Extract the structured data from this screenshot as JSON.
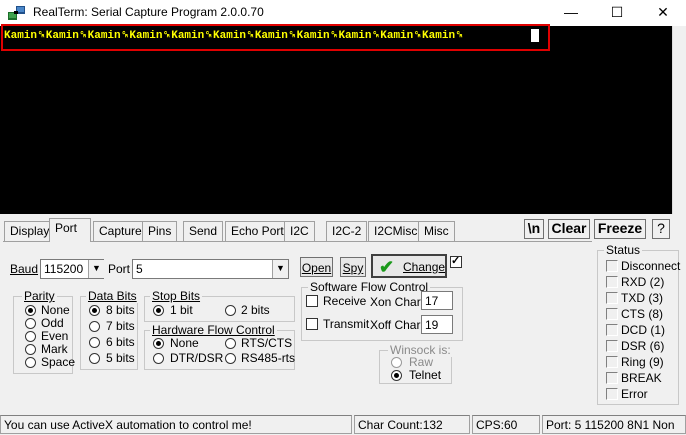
{
  "window": {
    "title": "RealTerm: Serial Capture Program 2.0.0.70",
    "min_icon": "minimize-icon",
    "max_icon": "maximize-icon",
    "close_icon": "close-icon"
  },
  "terminal": {
    "text": "Kamin␍Kamin␍Kamin␍Kamin␍Kamin␍Kamin␍Kamin␍Kamin␍Kamin␍Kamin␍Kamin␍",
    "text_color": "#ffff00",
    "background": "#000000",
    "highlight_color": "#e00000"
  },
  "tabs": [
    "Display",
    "Port",
    "Capture",
    "Pins",
    "Send",
    "Echo Port",
    "I2C",
    "I2C-2",
    "I2CMisc",
    "Misc"
  ],
  "active_tab": "Port",
  "top_buttons": {
    "newline": "\\n",
    "clear": "Clear",
    "freeze": "Freeze",
    "help": "?"
  },
  "port": {
    "baud_label": "Baud",
    "baud_value": "115200",
    "port_label": "Port",
    "port_value": "5",
    "open_label": "Open",
    "spy_label": "Spy",
    "change_label": "Change",
    "change_checked": true
  },
  "parity": {
    "title": "Parity",
    "options": [
      "None",
      "Odd",
      "Even",
      "Mark",
      "Space"
    ],
    "selected": "None"
  },
  "data_bits": {
    "title": "Data Bits",
    "options": [
      "8 bits",
      "7 bits",
      "6 bits",
      "5 bits"
    ],
    "selected": "8 bits"
  },
  "stop_bits": {
    "title": "Stop Bits",
    "options": [
      "1 bit",
      "2 bits"
    ],
    "selected": "1 bit"
  },
  "hw_flow": {
    "title": "Hardware Flow Control",
    "options": [
      "None",
      "RTS/CTS",
      "DTR/DSR",
      "RS485-rts"
    ],
    "selected": "None"
  },
  "sw_flow": {
    "title": "Software Flow Control",
    "receive_label": "Receive",
    "transmit_label": "Transmit",
    "xon_label": "Xon Char:",
    "xon_value": "17",
    "xoff_label": "Xoff Char:",
    "xoff_value": "19"
  },
  "winsock": {
    "title": "Winsock is:",
    "options": [
      "Raw",
      "Telnet"
    ],
    "selected": "Telnet"
  },
  "status": {
    "title": "Status",
    "items": [
      "Disconnect",
      "RXD (2)",
      "TXD (3)",
      "CTS (8)",
      "DCD (1)",
      "DSR (6)",
      "Ring (9)",
      "BREAK",
      "Error"
    ]
  },
  "statusbar": {
    "message": "You can use ActiveX automation to control me!",
    "char_count": "Char Count:132",
    "cps": "CPS:60",
    "port_info": "Port: 5 115200 8N1 Non"
  }
}
